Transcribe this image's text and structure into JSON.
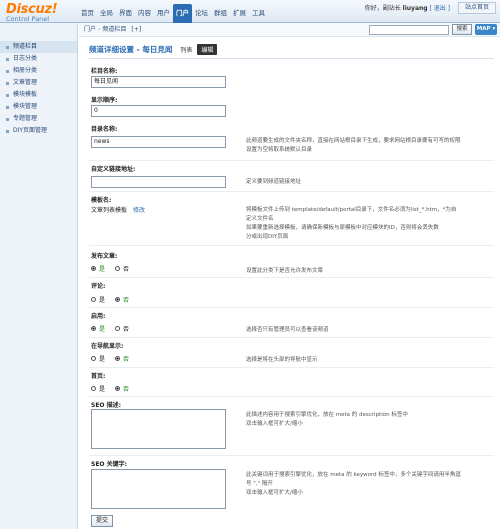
{
  "header": {
    "logo_brand": "Discuz!",
    "logo_sub": "Control Panel",
    "nav": [
      "首页",
      "全局",
      "界面",
      "内容",
      "用户",
      "门户",
      "论坛",
      "群组",
      "扩展",
      "工具"
    ],
    "active_nav": "门户",
    "greeting": "你好，副站长",
    "username": "liuyang",
    "logout": "[ 退出 ]",
    "site_home": "站点首页"
  },
  "sidebar": {
    "items": [
      "频道栏目",
      "日志分类",
      "相册分类",
      "文章管理",
      "模块模板",
      "模块管理",
      "专题管理",
      "DIY页面管理"
    ],
    "active": "频道栏目"
  },
  "breadcrumb": {
    "root": "门户",
    "current": "频道栏目",
    "star": "[+]",
    "search_button": "搜索",
    "map_button": "MAP ▾"
  },
  "page": {
    "title": "频道详细设置 - 每日見闻",
    "tabs": [
      "列表",
      "编辑"
    ],
    "active_tab": "编辑"
  },
  "form": {
    "name_label": "栏目名称:",
    "name_value": "每日见闻",
    "order_label": "显示顺序:",
    "order_value": "0",
    "dir_label": "目录名称:",
    "dir_value": "news",
    "dir_help": [
      "此频道要生成的文件夹名称，直接在网站根目录下生成，要求网站根目录要有可写的权限",
      "设置为空将取系统默认目录"
    ],
    "domain_label": "自定义链接地址:",
    "domain_help": "定义要到频道链接地址",
    "template_label": "模板名:",
    "template_value": "文章列表模板",
    "template_edit": "修改",
    "template_help": [
      "将模板文件上传到 template/default/portal目录下，文件名必须为list_*.htm，*为自",
      "定义文件名",
      "如果要重新选择模板，请确保新模板与原模板中对应模块的ID，否则将会丢失数",
      "分或出现DIY页面"
    ],
    "publish_label": "发布文章:",
    "publish_help": "设置此分类下是否允许发布文章",
    "comment_label": "评论:",
    "enable_label": "启用:",
    "enable_help": "选择否只有管理员可以查看该频道",
    "nav_label": "在导航显示:",
    "nav_help": "选择是将在头部的导航中显示",
    "home_label": "首页:",
    "seo_desc_label": "SEO 描述:",
    "seo_desc_help": [
      "此描述内容用于搜索引擎优化，放在 meta 的 description 标签中",
      "双击输入框可扩大/缩小"
    ],
    "seo_kw_label": "SEO 关键字:",
    "seo_kw_help": [
      "此关键词用于搜索引擎优化，放在 meta 的 keyword 标签中，多个关键字间请用半角逗",
      "号 \",\" 隔开",
      "双击输入框可扩大/缩小"
    ],
    "yes": "是",
    "no": "否",
    "submit": "提交"
  },
  "radios": {
    "publish": "yes",
    "comment": "no",
    "enable": "yes",
    "nav": "no",
    "home": "no"
  }
}
